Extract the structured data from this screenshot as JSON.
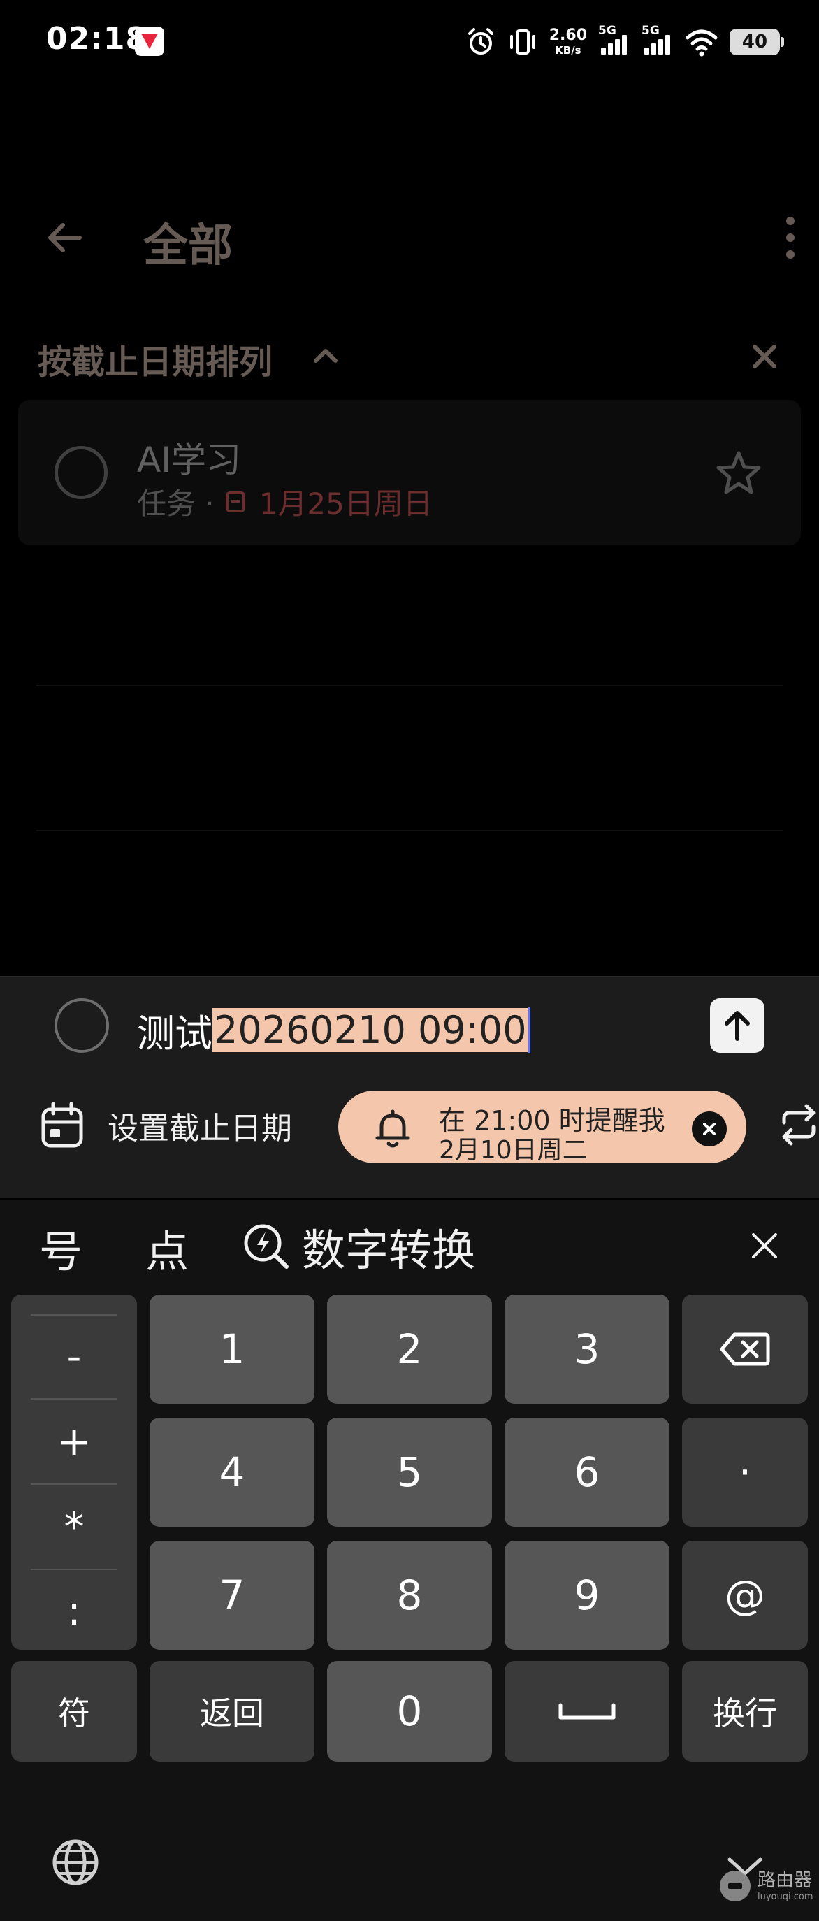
{
  "status_bar": {
    "time": "02:18",
    "net_speed_value": "2.60",
    "net_speed_unit": "KB/s",
    "sim1_label": "5G",
    "sim2_label": "5G",
    "battery": "40"
  },
  "header": {
    "title": "全部"
  },
  "sort": {
    "label": "按截止日期排列"
  },
  "tasks": [
    {
      "title": "AI学习",
      "list": "任务 ·",
      "due": "1月25日周日",
      "due_color": "#ff6b6b"
    }
  ],
  "composer": {
    "text_plain": "测试",
    "text_highlighted": "20260210 09:00",
    "set_due_label": "设置截止日期",
    "reminder_line1": "在 21:00 时提醒我",
    "reminder_line2": "2月10日周二",
    "accent": "#f4c7ad"
  },
  "keyboard": {
    "candidates": [
      "号",
      "点"
    ],
    "convert_label": "数字转换",
    "symbols": [
      "-",
      "+",
      "*",
      ":"
    ],
    "digits": [
      "1",
      "2",
      "3",
      "4",
      "5",
      "6",
      "7",
      "8",
      "9",
      "0"
    ],
    "dot_key": "·",
    "at_key": "@",
    "symbol_key": "符",
    "back_key": "返回",
    "newline_key": "换行"
  },
  "watermark": {
    "name": "路由器",
    "domain": "luyouqi.com"
  }
}
